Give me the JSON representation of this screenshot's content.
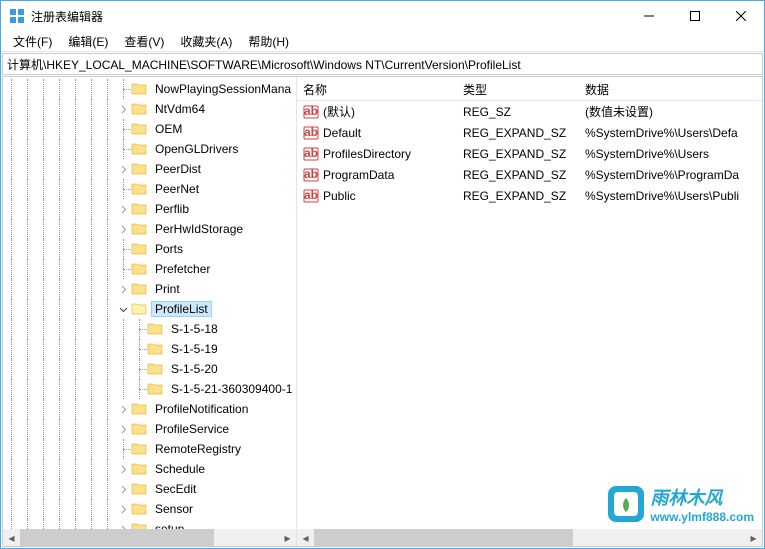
{
  "window": {
    "title": "注册表编辑器"
  },
  "menu": {
    "file": "文件(F)",
    "edit": "编辑(E)",
    "view": "查看(V)",
    "favorites": "收藏夹(A)",
    "help": "帮助(H)"
  },
  "address": "计算机\\HKEY_LOCAL_MACHINE\\SOFTWARE\\Microsoft\\Windows NT\\CurrentVersion\\ProfileList",
  "tree": [
    {
      "label": "NowPlayingSessionMana",
      "level": 7,
      "expandable": false,
      "selected": false
    },
    {
      "label": "NtVdm64",
      "level": 7,
      "expandable": true,
      "selected": false
    },
    {
      "label": "OEM",
      "level": 7,
      "expandable": false,
      "selected": false
    },
    {
      "label": "OpenGLDrivers",
      "level": 7,
      "expandable": false,
      "selected": false
    },
    {
      "label": "PeerDist",
      "level": 7,
      "expandable": true,
      "selected": false
    },
    {
      "label": "PeerNet",
      "level": 7,
      "expandable": false,
      "selected": false
    },
    {
      "label": "Perflib",
      "level": 7,
      "expandable": true,
      "selected": false
    },
    {
      "label": "PerHwIdStorage",
      "level": 7,
      "expandable": true,
      "selected": false
    },
    {
      "label": "Ports",
      "level": 7,
      "expandable": false,
      "selected": false
    },
    {
      "label": "Prefetcher",
      "level": 7,
      "expandable": false,
      "selected": false
    },
    {
      "label": "Print",
      "level": 7,
      "expandable": true,
      "selected": false
    },
    {
      "label": "ProfileList",
      "level": 7,
      "expandable": true,
      "expanded": true,
      "selected": true
    },
    {
      "label": "S-1-5-18",
      "level": 8,
      "expandable": false,
      "selected": false
    },
    {
      "label": "S-1-5-19",
      "level": 8,
      "expandable": false,
      "selected": false
    },
    {
      "label": "S-1-5-20",
      "level": 8,
      "expandable": false,
      "selected": false
    },
    {
      "label": "S-1-5-21-360309400-1",
      "level": 8,
      "expandable": false,
      "selected": false
    },
    {
      "label": "ProfileNotification",
      "level": 7,
      "expandable": true,
      "selected": false
    },
    {
      "label": "ProfileService",
      "level": 7,
      "expandable": true,
      "selected": false
    },
    {
      "label": "RemoteRegistry",
      "level": 7,
      "expandable": false,
      "selected": false
    },
    {
      "label": "Schedule",
      "level": 7,
      "expandable": true,
      "selected": false
    },
    {
      "label": "SecEdit",
      "level": 7,
      "expandable": true,
      "selected": false
    },
    {
      "label": "Sensor",
      "level": 7,
      "expandable": true,
      "selected": false
    },
    {
      "label": "setup",
      "level": 7,
      "expandable": true,
      "selected": false
    }
  ],
  "columns": {
    "name": "名称",
    "type": "类型",
    "data": "数据"
  },
  "values": [
    {
      "name": "(默认)",
      "type": "REG_SZ",
      "data": "(数值未设置)"
    },
    {
      "name": "Default",
      "type": "REG_EXPAND_SZ",
      "data": "%SystemDrive%\\Users\\Defa"
    },
    {
      "name": "ProfilesDirectory",
      "type": "REG_EXPAND_SZ",
      "data": "%SystemDrive%\\Users"
    },
    {
      "name": "ProgramData",
      "type": "REG_EXPAND_SZ",
      "data": "%SystemDrive%\\ProgramDa"
    },
    {
      "name": "Public",
      "type": "REG_EXPAND_SZ",
      "data": "%SystemDrive%\\Users\\Publi"
    }
  ],
  "watermark": {
    "title": "雨林木风",
    "url": "www.ylmf888.com"
  }
}
